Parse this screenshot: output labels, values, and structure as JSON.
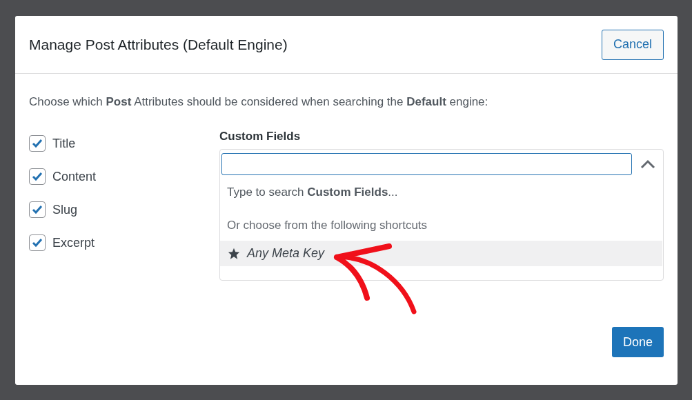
{
  "dialog": {
    "title": "Manage Post Attributes (Default Engine)",
    "cancel_button": "Cancel",
    "intro": "Choose which **Post** Attributes should be considered when searching the **Default** engine:",
    "attributes": [
      {
        "label": "Title",
        "checked": true
      },
      {
        "label": "Content",
        "checked": true
      },
      {
        "label": "Slug",
        "checked": true
      },
      {
        "label": "Excerpt",
        "checked": true
      }
    ],
    "custom_fields": {
      "label": "Custom Fields",
      "expanded": true,
      "hint": "Type to search **Custom Fields**...",
      "shortcuts_heading": "Or choose from the following shortcuts",
      "shortcuts": [
        {
          "label": "Any Meta Key",
          "highlighted": true
        }
      ]
    },
    "done_button": "Done"
  }
}
